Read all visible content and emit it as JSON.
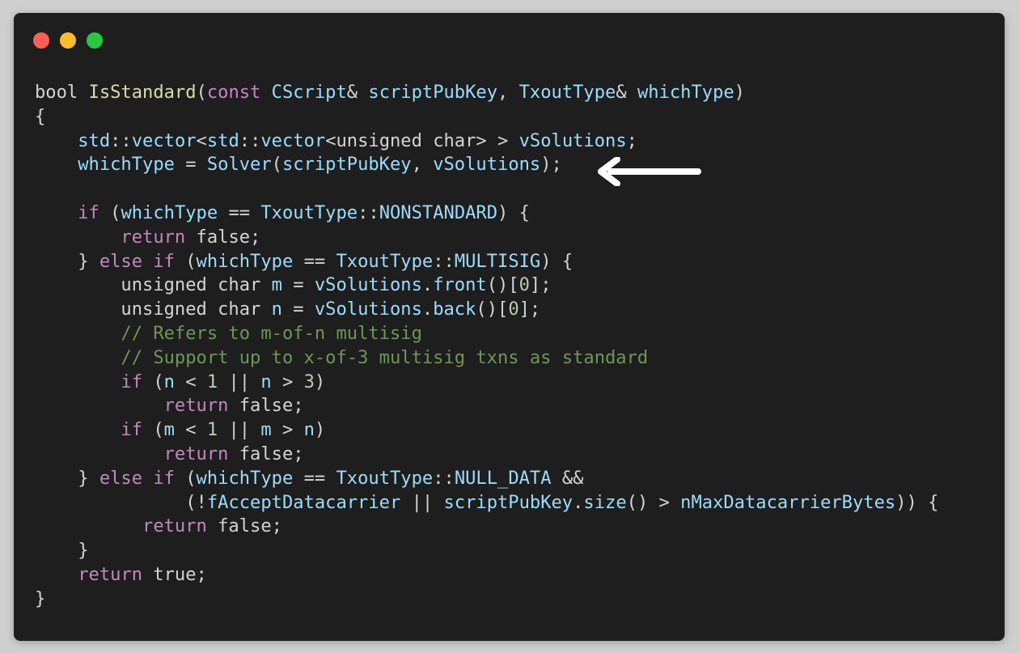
{
  "window": {
    "controls": [
      {
        "name": "close-button",
        "color": "#ff5f56"
      },
      {
        "name": "minimize-button",
        "color": "#ffbd2e"
      },
      {
        "name": "maximize-button",
        "color": "#27c93f"
      }
    ]
  },
  "colors": {
    "background": "#1e1e1e",
    "default": "#d4d4d4",
    "keyword": "#c586c0",
    "type": "#4fc1ff",
    "variable": "#9cdcfe",
    "function": "#dcdcaa",
    "number": "#b5cea8",
    "comment": "#6a9955"
  },
  "arrow": {
    "icon": "left-arrow-icon",
    "color": "#ffffff"
  },
  "code_lines": [
    [
      [
        "t",
        "bool "
      ],
      [
        "f",
        "IsStandard"
      ],
      [
        "t",
        "("
      ],
      [
        "k",
        "const "
      ],
      [
        "v",
        "CScript"
      ],
      [
        "t",
        "& "
      ],
      [
        "v",
        "scriptPubKey"
      ],
      [
        "t",
        ", "
      ],
      [
        "v",
        "TxoutType"
      ],
      [
        "t",
        "& "
      ],
      [
        "v",
        "whichType"
      ],
      [
        "t",
        ")"
      ]
    ],
    [
      [
        "t",
        "{"
      ]
    ],
    [
      [
        "t",
        "    "
      ],
      [
        "v",
        "std"
      ],
      [
        "t",
        "::"
      ],
      [
        "v",
        "vector"
      ],
      [
        "t",
        "<"
      ],
      [
        "v",
        "std"
      ],
      [
        "t",
        "::"
      ],
      [
        "v",
        "vector"
      ],
      [
        "t",
        "<unsigned char> > "
      ],
      [
        "v",
        "vSolutions"
      ],
      [
        "t",
        ";"
      ]
    ],
    [
      [
        "t",
        "    "
      ],
      [
        "v",
        "whichType"
      ],
      [
        "t",
        " = "
      ],
      [
        "v",
        "Solver"
      ],
      [
        "t",
        "("
      ],
      [
        "v",
        "scriptPubKey"
      ],
      [
        "t",
        ", "
      ],
      [
        "v",
        "vSolutions"
      ],
      [
        "t",
        ");"
      ]
    ],
    [],
    [
      [
        "t",
        "    "
      ],
      [
        "k",
        "if"
      ],
      [
        "t",
        " ("
      ],
      [
        "v",
        "whichType"
      ],
      [
        "t",
        " == "
      ],
      [
        "v",
        "TxoutType"
      ],
      [
        "t",
        "::"
      ],
      [
        "v",
        "NONSTANDARD"
      ],
      [
        "t",
        ") {"
      ]
    ],
    [
      [
        "t",
        "        "
      ],
      [
        "k",
        "return"
      ],
      [
        "t",
        " false;"
      ]
    ],
    [
      [
        "t",
        "    } "
      ],
      [
        "k",
        "else if"
      ],
      [
        "t",
        " ("
      ],
      [
        "v",
        "whichType"
      ],
      [
        "t",
        " == "
      ],
      [
        "v",
        "TxoutType"
      ],
      [
        "t",
        "::"
      ],
      [
        "v",
        "MULTISIG"
      ],
      [
        "t",
        ") {"
      ]
    ],
    [
      [
        "t",
        "        unsigned char "
      ],
      [
        "v",
        "m"
      ],
      [
        "t",
        " = "
      ],
      [
        "v",
        "vSolutions"
      ],
      [
        "t",
        "."
      ],
      [
        "v",
        "front"
      ],
      [
        "t",
        "()["
      ],
      [
        "n",
        "0"
      ],
      [
        "t",
        "];"
      ]
    ],
    [
      [
        "t",
        "        unsigned char "
      ],
      [
        "v",
        "n"
      ],
      [
        "t",
        " = "
      ],
      [
        "v",
        "vSolutions"
      ],
      [
        "t",
        "."
      ],
      [
        "v",
        "back"
      ],
      [
        "t",
        "()["
      ],
      [
        "n",
        "0"
      ],
      [
        "t",
        "];"
      ]
    ],
    [
      [
        "t",
        "        "
      ],
      [
        "c",
        "// Refers to m-of-n multisig"
      ]
    ],
    [
      [
        "t",
        "        "
      ],
      [
        "c",
        "// Support up to x-of-3 multisig txns as standard"
      ]
    ],
    [
      [
        "t",
        "        "
      ],
      [
        "k",
        "if"
      ],
      [
        "t",
        " ("
      ],
      [
        "v",
        "n"
      ],
      [
        "t",
        " < "
      ],
      [
        "n",
        "1"
      ],
      [
        "t",
        " || "
      ],
      [
        "v",
        "n"
      ],
      [
        "t",
        " > "
      ],
      [
        "n",
        "3"
      ],
      [
        "t",
        ")"
      ]
    ],
    [
      [
        "t",
        "            "
      ],
      [
        "k",
        "return"
      ],
      [
        "t",
        " false;"
      ]
    ],
    [
      [
        "t",
        "        "
      ],
      [
        "k",
        "if"
      ],
      [
        "t",
        " ("
      ],
      [
        "v",
        "m"
      ],
      [
        "t",
        " < "
      ],
      [
        "n",
        "1"
      ],
      [
        "t",
        " || "
      ],
      [
        "v",
        "m"
      ],
      [
        "t",
        " > "
      ],
      [
        "v",
        "n"
      ],
      [
        "t",
        ")"
      ]
    ],
    [
      [
        "t",
        "            "
      ],
      [
        "k",
        "return"
      ],
      [
        "t",
        " false;"
      ]
    ],
    [
      [
        "t",
        "    } "
      ],
      [
        "k",
        "else if"
      ],
      [
        "t",
        " ("
      ],
      [
        "v",
        "whichType"
      ],
      [
        "t",
        " == "
      ],
      [
        "v",
        "TxoutType"
      ],
      [
        "t",
        "::"
      ],
      [
        "v",
        "NULL_DATA"
      ],
      [
        "t",
        " &&"
      ]
    ],
    [
      [
        "t",
        "              (!"
      ],
      [
        "v",
        "fAcceptDatacarrier"
      ],
      [
        "t",
        " || "
      ],
      [
        "v",
        "scriptPubKey"
      ],
      [
        "t",
        "."
      ],
      [
        "v",
        "size"
      ],
      [
        "t",
        "() > "
      ],
      [
        "v",
        "nMaxDatacarrierBytes"
      ],
      [
        "t",
        ")) {"
      ]
    ],
    [
      [
        "t",
        "          "
      ],
      [
        "k",
        "return"
      ],
      [
        "t",
        " false;"
      ]
    ],
    [
      [
        "t",
        "    }"
      ]
    ],
    [
      [
        "t",
        "    "
      ],
      [
        "k",
        "return"
      ],
      [
        "t",
        " true;"
      ]
    ],
    [
      [
        "t",
        "}"
      ]
    ]
  ]
}
